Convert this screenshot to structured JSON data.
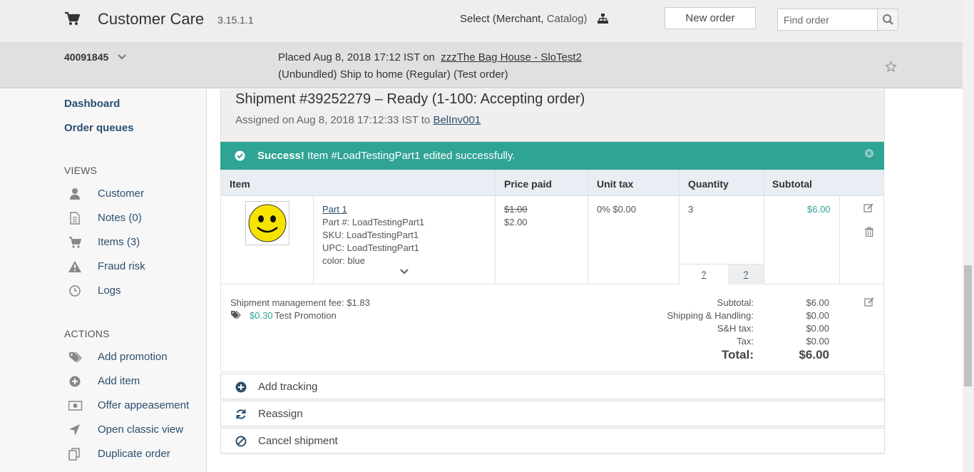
{
  "topbar": {
    "app_title": "Customer Care",
    "version": "3.15.1.1",
    "select_label": "Select (Merchant,",
    "select_catalog": "Catalog)",
    "new_order_label": "New order",
    "find_placeholder": "Find order"
  },
  "order": {
    "id": "40091845",
    "placed_prefix": "Placed Aug 8, 2018 17:12 IST on",
    "store_link": "zzzThe Bag House - SloTest2",
    "ship_line": "(Unbundled)  Ship to home (Regular) (Test order)"
  },
  "sidebar": {
    "dashboard": "Dashboard",
    "order_queues": "Order queues",
    "views_heading": "VIEWS",
    "views": [
      {
        "label": "Customer",
        "icon": "user-icon"
      },
      {
        "label": "Notes (0)",
        "icon": "notes-icon"
      },
      {
        "label": "Items (3)",
        "icon": "cart-icon"
      },
      {
        "label": "Fraud risk",
        "icon": "warning-icon"
      },
      {
        "label": "Logs",
        "icon": "clock-icon"
      }
    ],
    "actions_heading": "ACTIONS",
    "actions": [
      {
        "label": "Add promotion",
        "icon": "tags-icon"
      },
      {
        "label": "Add item",
        "icon": "plus-circle-icon"
      },
      {
        "label": "Offer appeasement",
        "icon": "money-icon"
      },
      {
        "label": "Open classic view",
        "icon": "location-arrow-icon"
      },
      {
        "label": "Duplicate order",
        "icon": "copy-icon"
      }
    ]
  },
  "shipment": {
    "title": "Shipment #39252279 – Ready (1-100: Accepting order)",
    "assigned_prefix": "Assigned on Aug 8, 2018 17:12:33 IST to",
    "assignee": "BelInv001",
    "alert_strong": "Success!",
    "alert_message": "Item #LoadTestingPart1 edited successfully."
  },
  "table": {
    "headers": [
      "Item",
      "Price paid",
      "Unit tax",
      "Quantity",
      "Subtotal"
    ],
    "row": {
      "name": "Part 1",
      "part_number": "Part #: LoadTestingPart1",
      "sku": "SKU: LoadTestingPart1",
      "upc": "UPC: LoadTestingPart1",
      "color": "color: blue",
      "price_old": "$1.00",
      "price_new": "$2.00",
      "tax": "0%   $0.00",
      "quantity": "3",
      "qty_a": "?",
      "qty_b": "?",
      "subtotal": "$6.00"
    }
  },
  "totals": {
    "fee": "Shipment management fee: $1.83",
    "promo_amount": "$0.30",
    "promo_name": "Test Promotion",
    "rows": [
      {
        "label": "Subtotal:",
        "value": "$6.00"
      },
      {
        "label": "Shipping & Handling:",
        "value": "$0.00"
      },
      {
        "label": "S&H tax:",
        "value": "$0.00"
      },
      {
        "label": "Tax:",
        "value": "$0.00"
      }
    ],
    "total_label": "Total:",
    "total_value": "$6.00"
  },
  "actions": {
    "add_tracking": "Add tracking",
    "reassign": "Reassign",
    "cancel_shipment": "Cancel shipment"
  },
  "colors": {
    "accent_teal": "#2fa394",
    "link": "#2c4f6e"
  }
}
